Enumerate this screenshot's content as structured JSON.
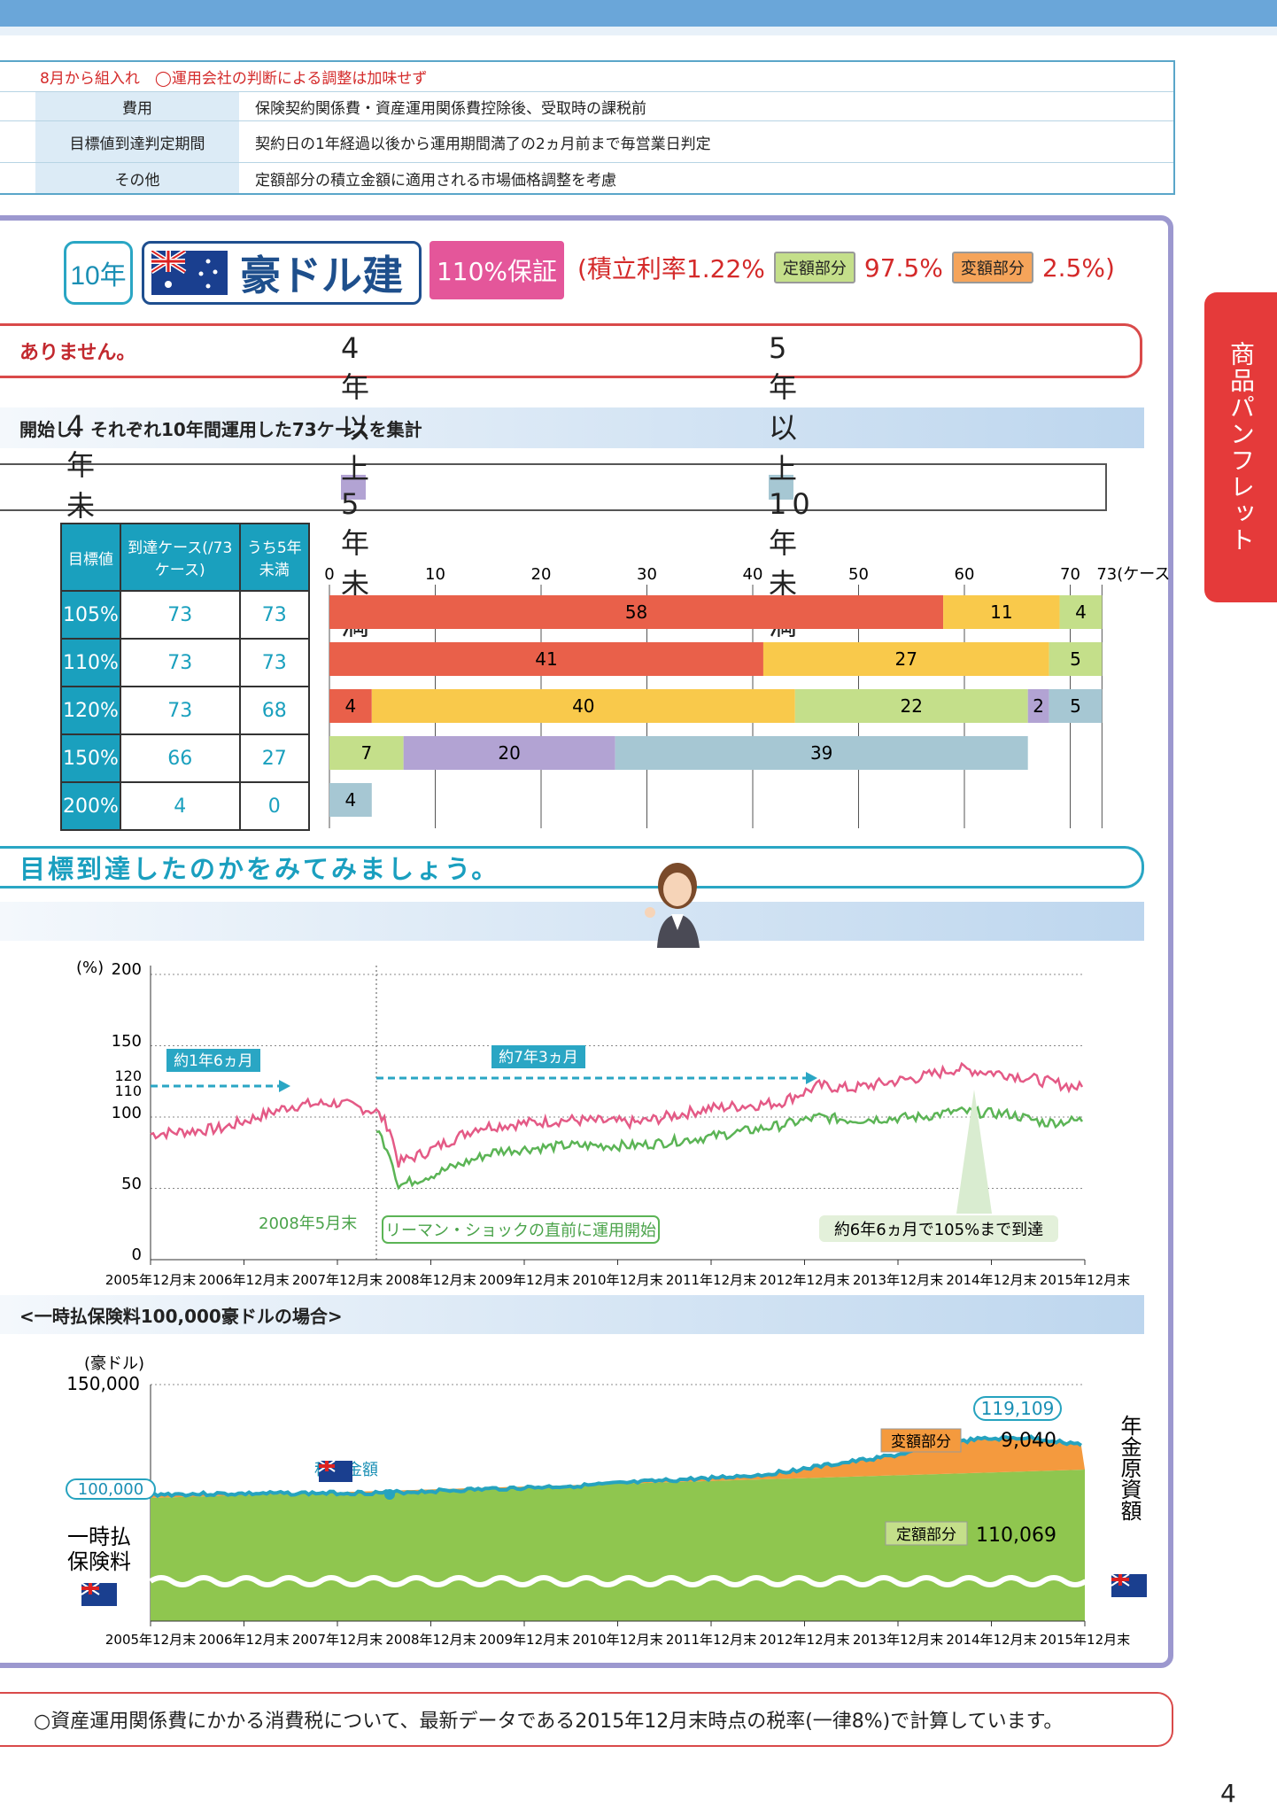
{
  "info": {
    "note": "8月から組入れ　◯運用会社の判断による調整は加味せず",
    "rows": [
      {
        "k": "費用",
        "v": "保険契約関係費・資産運用関係費控除後、受取時の課税前"
      },
      {
        "k": "目標値到達判定期間",
        "v": "契約日の1年経過以後から運用期間満了の2ヵ月前まで毎営業日判定"
      },
      {
        "k": "その他",
        "v": "定額部分の積立金額に適用される市場価格調整を考慮"
      }
    ]
  },
  "side_tab": "商品パンフレット",
  "product": {
    "years": "10年",
    "currency": "豪ドル建",
    "guarantee": "110%保証",
    "rate_text": "(積立利率1.22%",
    "fixed_label": "定額部分",
    "fixed_val": "97.5%",
    "var_label": "変額部分",
    "var_val": "2.5%)"
  },
  "pill_text": "ありません。",
  "band1": "開始し、それぞれ10年間運用した73ケースを集計",
  "legend": {
    "l1": "4年未満",
    "l2": "4年以上5年未満",
    "l3": "5年以上10年未満",
    "c2": "#b2a3d3",
    "c3": "#a6c7d3"
  },
  "target_table": {
    "h1": "目標値",
    "h2": "到達ケース(/73ケース)",
    "h3": "うち5年未満",
    "rows": [
      {
        "t": "105%",
        "a": "73",
        "b": "73"
      },
      {
        "t": "110%",
        "a": "73",
        "b": "73"
      },
      {
        "t": "120%",
        "a": "73",
        "b": "68"
      },
      {
        "t": "150%",
        "a": "66",
        "b": "27"
      },
      {
        "t": "200%",
        "a": "4",
        "b": "0"
      }
    ]
  },
  "bar_chart": {
    "type": "bar",
    "axis_ticks": [
      "0",
      "10",
      "20",
      "30",
      "40",
      "50",
      "60",
      "70",
      "73(ケース)"
    ],
    "colors": [
      "#e9604a",
      "#f9c94b",
      "#c4df8a",
      "#b2a3d3",
      "#a6c7d3"
    ],
    "rows": [
      [
        58,
        11,
        4,
        0,
        0
      ],
      [
        41,
        27,
        5,
        0,
        0
      ],
      [
        4,
        40,
        22,
        2,
        5
      ],
      [
        0,
        0,
        7,
        20,
        39
      ],
      [
        0,
        0,
        0,
        0,
        4
      ]
    ]
  },
  "bubble": "目標到達したのかをみてみましょう。",
  "band2": "",
  "line_chart": {
    "type": "line",
    "ylabel": "(%)",
    "yticks": [
      "200",
      "150",
      "120",
      "110",
      "100",
      "50",
      "0"
    ],
    "xticks": [
      "2005年12月末",
      "2006年12月末",
      "2007年12月末",
      "2008年12月末",
      "2009年12月末",
      "2010年12月末",
      "2011年12月末",
      "2012年12月末",
      "2013年12月末",
      "2014年12月末",
      "2015年12月末"
    ],
    "ann1": "約1年6ヵ月",
    "ann2": "約7年3ヵ月",
    "start": "2008年5月末",
    "lehman": "リーマン・ショックの直前に運用開始",
    "reach": "約6年6ヵ月で105%まで到達"
  },
  "band3": "<一時払保険料100,000豪ドルの場合>",
  "area_chart": {
    "type": "area",
    "ylabel": "(豪ドル)",
    "ytick": "150,000",
    "start_val": "100,000",
    "total": "119,109",
    "var_label": "変額部分",
    "var_val": "9,040",
    "fixed_label": "定額部分",
    "fixed_val": "110,069",
    "accum": "積立金額",
    "left_label1": "一時払",
    "left_label2": "保険料",
    "right_label": "年金原資額"
  },
  "footer": "○資産運用関係費にかかる消費税について、最新データである2015年12月末時点の税率(一律8%)で計算しています。",
  "page_no": "4"
}
